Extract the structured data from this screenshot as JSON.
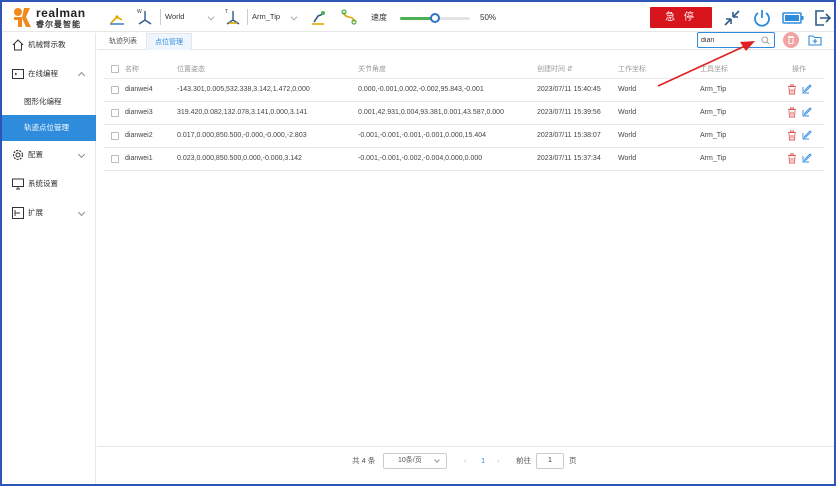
{
  "brand": {
    "name": "realman",
    "name_cn": "睿尔曼智能"
  },
  "toolbar": {
    "coord_select": "World",
    "tool_select": "Arm_Tip",
    "speed_label": "速度",
    "speed_value": "50%",
    "speed_fraction": 0.5,
    "estop_label": "急 停"
  },
  "sidebar": {
    "items": [
      {
        "label": "机械臂示教",
        "icon": "home-icon"
      },
      {
        "label": "在线编程",
        "icon": "code-icon"
      },
      {
        "label": "配置",
        "icon": "gear-icon"
      },
      {
        "label": "系统设置",
        "icon": "monitor-icon"
      },
      {
        "label": "扩展",
        "icon": "extend-icon"
      }
    ],
    "sub_items": [
      {
        "label": "图形化编程"
      },
      {
        "label": "轨迹点位管理"
      }
    ]
  },
  "tabs": [
    {
      "label": "轨迹列表"
    },
    {
      "label": "点位管理"
    }
  ],
  "search": {
    "value": "dian",
    "placeholder": ""
  },
  "table": {
    "headers": [
      "名称",
      "位置姿态",
      "关节角度",
      "创建时间",
      "工作坐标",
      "工具坐标",
      "操作"
    ],
    "rows": [
      {
        "name": "dianwei4",
        "pose": "-143.301,0.005,532.338,3.142,1.472,0.000",
        "joints": "0.000,-0.001,0.002,-0.002,95.843,-0.001",
        "time": "2023/07/11 15:40:45",
        "work": "World",
        "tool": "Arm_Tip"
      },
      {
        "name": "dianwei3",
        "pose": "319.420,0.082,132.078,3.141,0.000,3.141",
        "joints": "0.001,42.931,0.004,93.381,0.001,43.587,0.000",
        "time": "2023/07/11 15:39:56",
        "work": "World",
        "tool": "Arm_Tip"
      },
      {
        "name": "dianwei2",
        "pose": "0.017,0.000,850.500,-0.000,-0.000,-2.803",
        "joints": "-0.001,-0.001,-0.001,-0.001,0.000,15.404",
        "time": "2023/07/11 15:38:07",
        "work": "World",
        "tool": "Arm_Tip"
      },
      {
        "name": "dianwei1",
        "pose": "0.023,0.000,850.500,0.000,-0.000,3.142",
        "joints": "-0.001,-0.001,-0.002,-0.004,0.000,0.000",
        "time": "2023/07/11 15:37:34",
        "work": "World",
        "tool": "Arm_Tip"
      }
    ]
  },
  "pagination": {
    "total": "共 4 条",
    "page_size": "10条/页",
    "current_page": "1",
    "goto_label": "前往",
    "goto_value": "1",
    "page_suffix": "页"
  },
  "colors": {
    "accent": "#2f8bdb",
    "estop": "#d8141c",
    "annotation": "#e02020"
  }
}
